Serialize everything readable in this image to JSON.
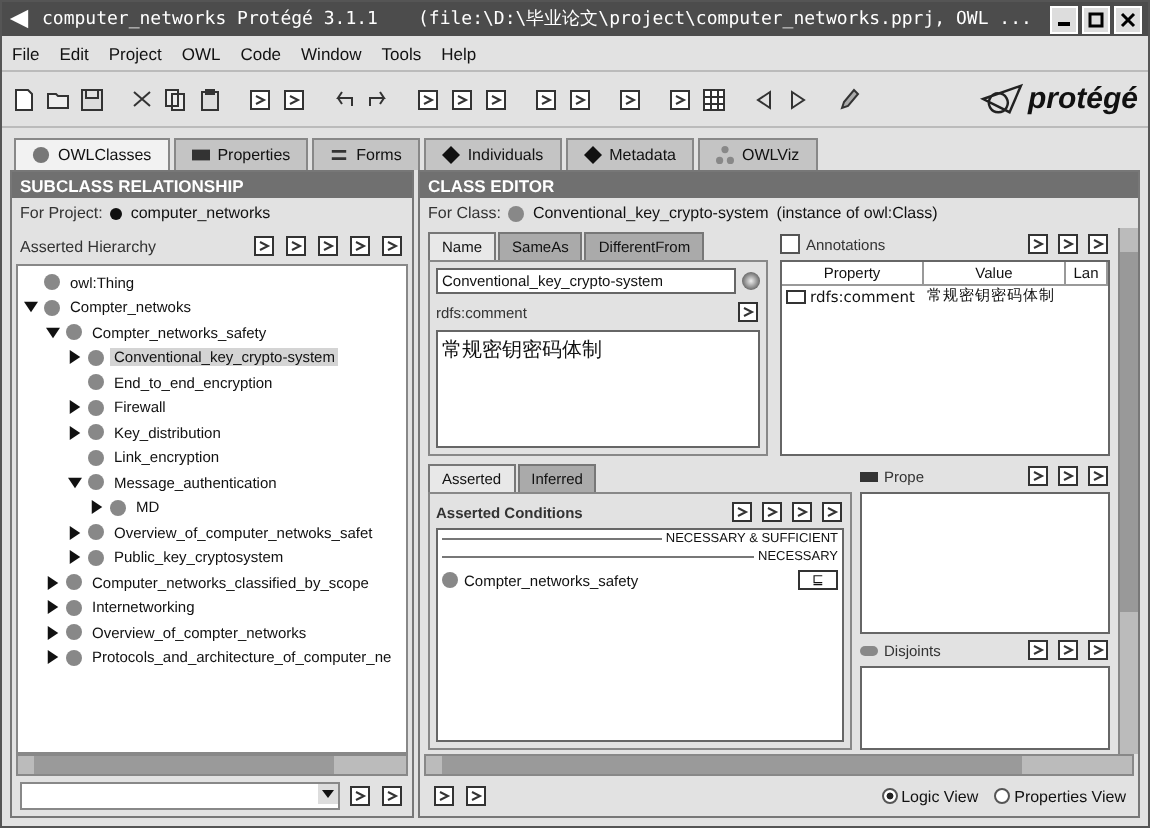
{
  "window": {
    "title": "computer_networks  Protégé 3.1.1",
    "file": "(file:\\D:\\毕业论文\\project\\computer_networks.pprj, OWL ..."
  },
  "menu": [
    "File",
    "Edit",
    "Project",
    "OWL",
    "Code",
    "Window",
    "Tools",
    "Help"
  ],
  "logo": "protégé",
  "tabs": [
    {
      "label": "OWLClasses",
      "selected": true
    },
    {
      "label": "Properties",
      "selected": false
    },
    {
      "label": "Forms",
      "selected": false
    },
    {
      "label": "Individuals",
      "selected": false
    },
    {
      "label": "Metadata",
      "selected": false
    },
    {
      "label": "OWLViz",
      "selected": false
    }
  ],
  "left_panel": {
    "header": "SUBCLASS RELATIONSHIP",
    "for_project_label": "For Project:",
    "project": "computer_networks",
    "hierarchy_label": "Asserted Hierarchy",
    "tree": [
      {
        "label": "owl:Thing",
        "selected": false
      },
      {
        "label": "Compter_netwoks",
        "selected": false,
        "expanded": true,
        "children": [
          {
            "label": "Compter_networks_safety",
            "selected": false,
            "expanded": true,
            "children": [
              {
                "label": "Conventional_key_crypto-system",
                "selected": true,
                "expanded": false
              },
              {
                "label": "End_to_end_encryption",
                "selected": false
              },
              {
                "label": "Firewall",
                "selected": false,
                "expanded": false
              },
              {
                "label": "Key_distribution",
                "selected": false,
                "expanded": false
              },
              {
                "label": "Link_encryption",
                "selected": false
              },
              {
                "label": "Message_authentication",
                "selected": false,
                "expanded": true,
                "children": [
                  {
                    "label": "MD",
                    "selected": false,
                    "expanded": false
                  }
                ]
              },
              {
                "label": "Overview_of_computer_netwoks_safet",
                "selected": false,
                "expanded": false
              },
              {
                "label": "Public_key_cryptosystem",
                "selected": false,
                "expanded": false
              }
            ]
          },
          {
            "label": "Computer_networks_classified_by_scope",
            "selected": false,
            "expanded": false
          },
          {
            "label": "Internetworking",
            "selected": false,
            "expanded": false
          },
          {
            "label": "Overview_of_compter_networks",
            "selected": false,
            "expanded": false
          },
          {
            "label": "Protocols_and_architecture_of_computer_ne",
            "selected": false,
            "expanded": false
          }
        ]
      }
    ]
  },
  "class_editor": {
    "header": "CLASS EDITOR",
    "for_class_label": "For Class:",
    "class_name": "Conventional_key_crypto-system",
    "instance_of": "(instance of owl:Class)",
    "name_tabs": [
      {
        "label": "Name",
        "selected": true
      },
      {
        "label": "SameAs",
        "selected": false
      },
      {
        "label": "DifferentFrom",
        "selected": false
      }
    ],
    "name_value": "Conventional_key_crypto-system",
    "comment_label": "rdfs:comment",
    "comment_value": "常规密钥密码体制",
    "annotations": {
      "label": "Annotations",
      "checked": false,
      "columns": [
        "Property",
        "Value",
        "Lan"
      ],
      "rows": [
        {
          "property": "rdfs:comment",
          "value": "常规密钥密码体制"
        }
      ]
    },
    "condition_tabs": [
      {
        "label": "Asserted",
        "selected": true
      },
      {
        "label": "Inferred",
        "selected": false
      }
    ],
    "conditions_label": "Asserted Conditions",
    "separators": [
      "NECESSARY & SUFFICIENT",
      "NECESSARY"
    ],
    "conditions": [
      {
        "label": "Compter_networks_safety",
        "symbol": "⊑"
      }
    ],
    "properties_label": "Prope",
    "disjoints_label": "Disjoints",
    "views": [
      {
        "label": "Logic View",
        "selected": true
      },
      {
        "label": "Properties View",
        "selected": false
      }
    ]
  }
}
